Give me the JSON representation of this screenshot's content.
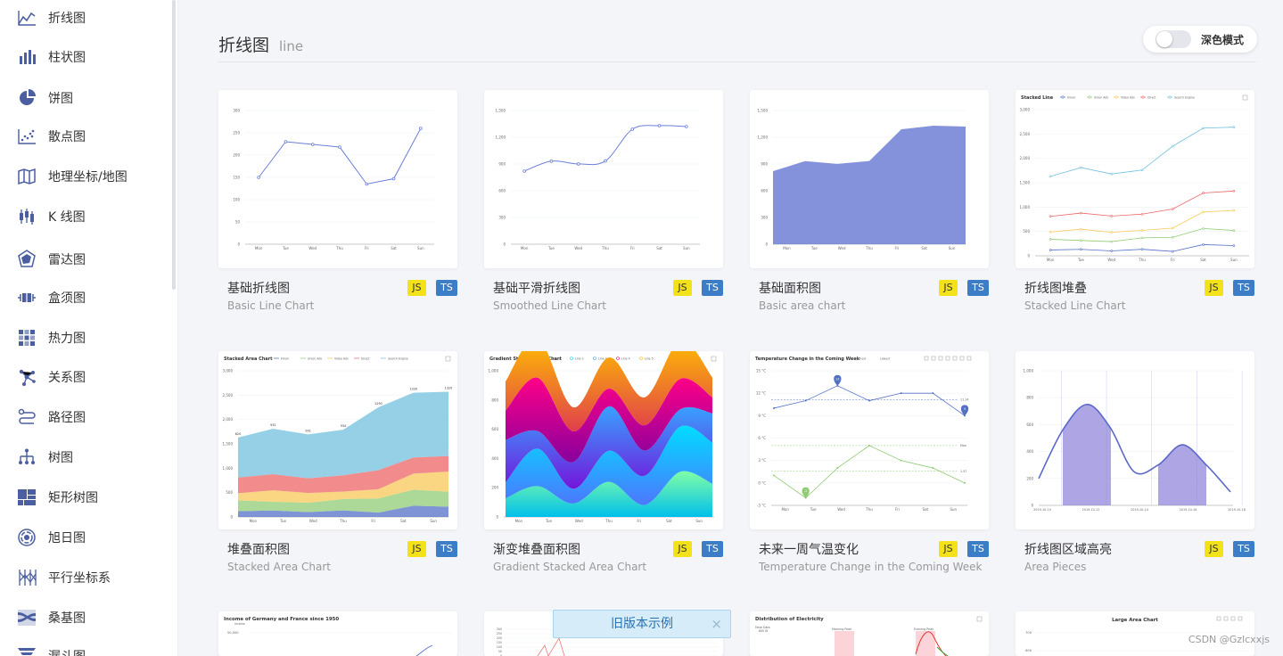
{
  "sidebar": {
    "items": [
      {
        "label": "折线图",
        "icon": "line-chart-icon"
      },
      {
        "label": "柱状图",
        "icon": "bar-chart-icon"
      },
      {
        "label": "饼图",
        "icon": "pie-chart-icon"
      },
      {
        "label": "散点图",
        "icon": "scatter-chart-icon"
      },
      {
        "label": "地理坐标/地图",
        "icon": "map-icon"
      },
      {
        "label": "K 线图",
        "icon": "candlestick-icon"
      },
      {
        "label": "雷达图",
        "icon": "radar-icon"
      },
      {
        "label": "盒须图",
        "icon": "boxplot-icon"
      },
      {
        "label": "热力图",
        "icon": "heatmap-icon"
      },
      {
        "label": "关系图",
        "icon": "graph-icon"
      },
      {
        "label": "路径图",
        "icon": "lines-icon"
      },
      {
        "label": "树图",
        "icon": "tree-icon"
      },
      {
        "label": "矩形树图",
        "icon": "treemap-icon"
      },
      {
        "label": "旭日图",
        "icon": "sunburst-icon"
      },
      {
        "label": "平行坐标系",
        "icon": "parallel-icon"
      },
      {
        "label": "桑基图",
        "icon": "sankey-icon"
      },
      {
        "label": "漏斗图",
        "icon": "funnel-icon"
      }
    ]
  },
  "header": {
    "title": "折线图",
    "subtitle": "line",
    "dark_mode_label": "深色模式",
    "dark_mode_on": false
  },
  "badges": {
    "js": "JS",
    "ts": "TS"
  },
  "cards": [
    {
      "title": "基础折线图",
      "subtitle": "Basic Line Chart"
    },
    {
      "title": "基础平滑折线图",
      "subtitle": "Smoothed Line Chart"
    },
    {
      "title": "基础面积图",
      "subtitle": "Basic area chart"
    },
    {
      "title": "折线图堆叠",
      "subtitle": "Stacked Line Chart"
    },
    {
      "title": "堆叠面积图",
      "subtitle": "Stacked Area Chart"
    },
    {
      "title": "渐变堆叠面积图",
      "subtitle": "Gradient Stacked Area Chart"
    },
    {
      "title": "未来一周气温变化",
      "subtitle": "Temperature Change in the Coming Week"
    },
    {
      "title": "折线图区域高亮",
      "subtitle": "Area Pieces"
    }
  ],
  "thumbs": {
    "weekdays": [
      "Mon",
      "Tue",
      "Wed",
      "Thu",
      "Fri",
      "Sat",
      "Sun"
    ],
    "basic_line": {
      "yticks": [
        "300",
        "250",
        "200",
        "150",
        "100",
        "50",
        "0"
      ],
      "values": [
        150,
        230,
        224,
        218,
        135,
        147,
        260
      ]
    },
    "smooth_line": {
      "yticks": [
        "1,500",
        "1,200",
        "900",
        "600",
        "300",
        "0"
      ],
      "values": [
        820,
        932,
        901,
        934,
        1290,
        1330,
        1320
      ]
    },
    "area": {
      "yticks": [
        "1,500",
        "1,200",
        "900",
        "600",
        "300",
        "0"
      ],
      "values": [
        820,
        932,
        901,
        934,
        1290,
        1330,
        1320
      ]
    },
    "stacked_line": {
      "title": "Stacked Line",
      "legend": [
        "Email",
        "Union Ads",
        "Video Ads",
        "Direct",
        "Search Engine"
      ],
      "yticks": [
        "3,000",
        "2,500",
        "2,000",
        "1,500",
        "1,000",
        "500",
        "0"
      ]
    },
    "stacked_area": {
      "title": "Stacked Area Chart",
      "legend": [
        "Email",
        "Union Ads",
        "Video Ads",
        "Direct",
        "Search Engine"
      ],
      "yticks": [
        "3,000",
        "2,500",
        "2,000",
        "1,500",
        "1,000",
        "500",
        "0"
      ],
      "top_labels": [
        "820",
        "932",
        "901",
        "934",
        "1290",
        "1330",
        "1320"
      ]
    },
    "gradient_area": {
      "title": "Gradient Stacked Area Chart",
      "legend": [
        "Line 1",
        "Line 2",
        "Line 3",
        "Line 4",
        "Line 5"
      ],
      "yticks": [
        "1,000",
        "800",
        "600",
        "400",
        "200",
        "0"
      ]
    },
    "temperature": {
      "title": "Temperature Change in the Coming Week",
      "legend": [
        "Highest",
        "Lowest"
      ],
      "yticks": [
        "15 °C",
        "12 °C",
        "9 °C",
        "6 °C",
        "3 °C",
        "0 °C",
        "-3 °C"
      ],
      "pin_max": "13",
      "pin_min": "9",
      "pin_low": "-2",
      "avg_high": "11.14",
      "max_label": "Max",
      "avg_low": "1.57"
    },
    "area_pieces": {
      "yticks": [
        "1,000",
        "800",
        "600",
        "400",
        "200",
        "0"
      ],
      "xticks": [
        "2019-10-10",
        "2019-10-12",
        "2019-10-14",
        "2019-10-16",
        "2019-10-18"
      ]
    },
    "row3": [
      {
        "title": "Income of Germany and France since 1950",
        "ylabel": "Income",
        "ytick": "50,000"
      },
      {
        "yticks": [
          "300",
          "250",
          "200",
          "150",
          "100",
          "50",
          "0"
        ]
      },
      {
        "title": "Distribution of Electricity",
        "ylabel": "False Data",
        "ytick": "800 W",
        "mark1": "Morning Peak",
        "mark2": "Evening Peak"
      },
      {
        "title": "Large Area Chart",
        "yticks": [
          "700",
          "600"
        ]
      }
    ]
  },
  "banner": {
    "text": "旧版本示例",
    "close": "×"
  },
  "watermark": "CSDN @Gzlcxxjs"
}
